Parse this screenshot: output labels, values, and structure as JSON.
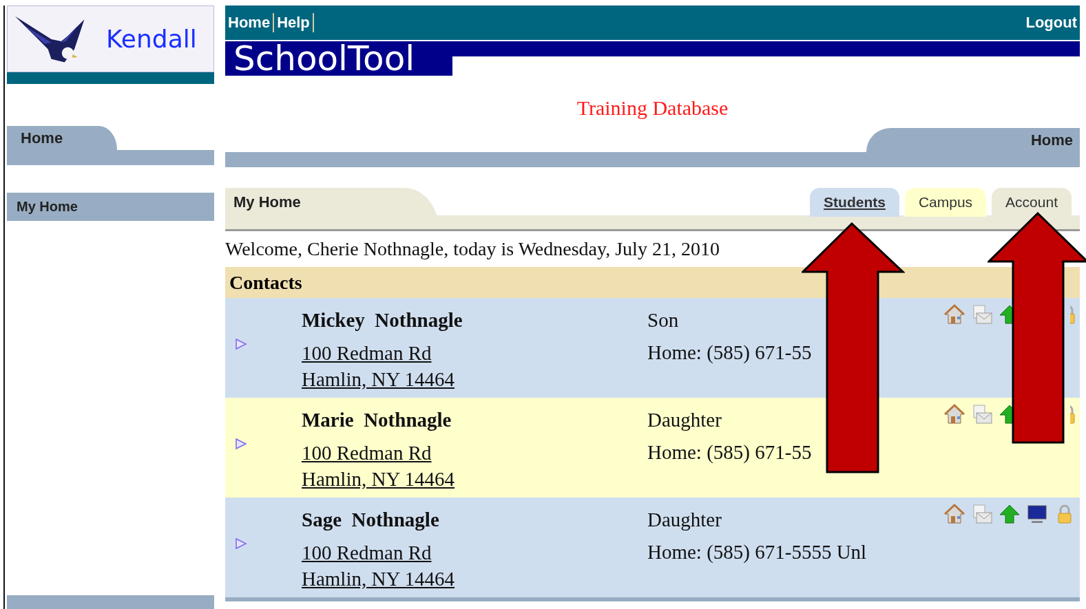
{
  "school_logo": {
    "text": "Kendall"
  },
  "top_nav": {
    "links": [
      "Home",
      "Help"
    ],
    "logout": "Logout"
  },
  "app_logo": "SchoolTool",
  "database_label": "Training Database",
  "sidebar": {
    "tab": "Home",
    "items": [
      {
        "label": "My Home",
        "selected": true
      }
    ]
  },
  "main_tab": "Home",
  "page": {
    "title": "My Home",
    "tabs": [
      {
        "label": "Students",
        "selected": true
      },
      {
        "label": "Campus",
        "selected": false
      },
      {
        "label": "Account",
        "selected": false
      }
    ]
  },
  "welcome": "Welcome, Cherie Nothnagle, today is Wednesday, July 21, 2010",
  "contacts": {
    "heading": "Contacts",
    "rows": [
      {
        "name": "Mickey  Nothnagle",
        "street": "100 Redman Rd",
        "city": "Hamlin, NY 14464",
        "relation": "Son",
        "phone": "Home: (585) 671-55",
        "kind": "covered"
      },
      {
        "name": "Marie  Nothnagle",
        "street": "100 Redman Rd",
        "city": "Hamlin, NY 14464",
        "relation": "Daughter",
        "phone": "Home: (585) 671-55",
        "kind": "covered"
      },
      {
        "name": "Sage  Nothnagle",
        "street": "100 Redman Rd",
        "city": "Hamlin, NY 14464",
        "relation": "Daughter",
        "phone": "Home: (585) 671-5555 Unl",
        "kind": "full"
      }
    ]
  }
}
